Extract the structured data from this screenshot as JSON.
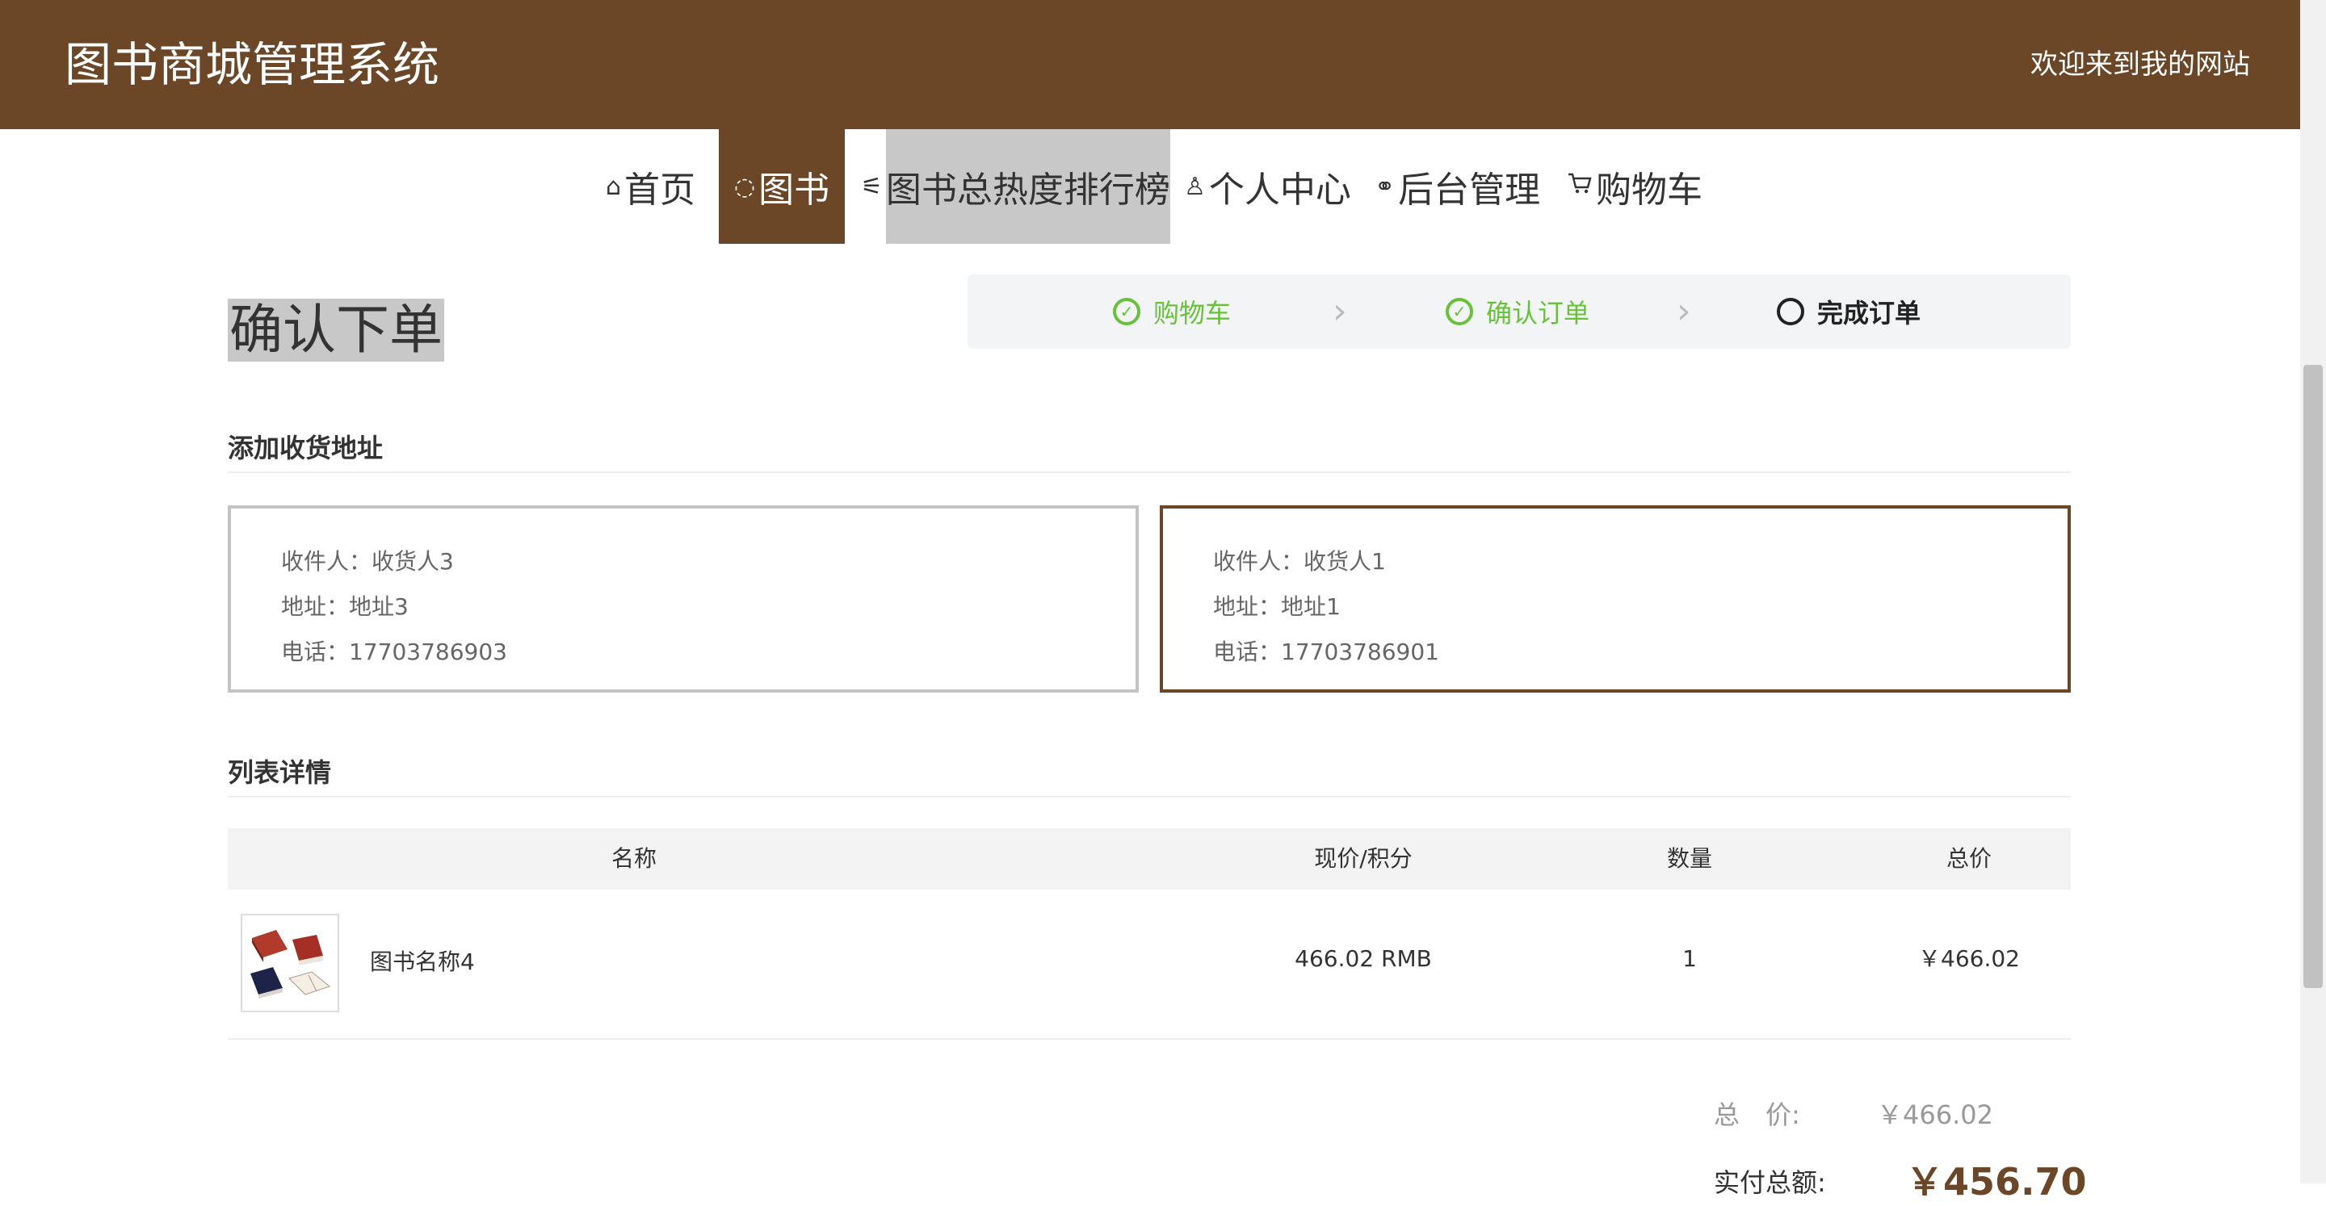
{
  "header": {
    "title": "图书商城管理系统",
    "welcome": "欢迎来到我的网站",
    "color": "#6b4627"
  },
  "nav": [
    {
      "label": "首页",
      "icon": "home-icon",
      "glyph": "⌂"
    },
    {
      "label": "图书",
      "icon": "book-icon",
      "glyph": "◌",
      "active": true
    },
    {
      "label": "图书总热度排行榜",
      "icon": "sliders-icon",
      "glyph": "⚟",
      "hover": true
    },
    {
      "label": "个人中心",
      "icon": "user-icon",
      "glyph": "♙"
    },
    {
      "label": "后台管理",
      "icon": "link-icon",
      "glyph": "⚭"
    },
    {
      "label": "购物车",
      "icon": "cart-icon",
      "glyph": "🛒"
    }
  ],
  "page": {
    "heading": "确认下单"
  },
  "steps": [
    {
      "label": "购物车",
      "state": "done"
    },
    {
      "label": "确认订单",
      "state": "done"
    },
    {
      "label": "完成订单",
      "state": "current"
    }
  ],
  "address_section": {
    "title": "添加收货地址"
  },
  "addresses": [
    {
      "recipient": "收件人：收货人3",
      "address": "地址：地址3",
      "phone": "电话：17703786903",
      "selected": false
    },
    {
      "recipient": "收件人：收货人1",
      "address": "地址：地址1",
      "phone": "电话：17703786901",
      "selected": true
    }
  ],
  "list_section": {
    "title": "列表详情"
  },
  "table": {
    "headers": [
      "名称",
      "现价/积分",
      "数量",
      "总价"
    ],
    "rows": [
      {
        "name": "图书名称4",
        "price": "466.02 RMB",
        "qty": "1",
        "total": "￥466.02"
      }
    ]
  },
  "totals": {
    "total_label": "总　价:",
    "total_value": "￥466.02",
    "pay_label": "实付总额:",
    "pay_value": "￥456.70"
  }
}
